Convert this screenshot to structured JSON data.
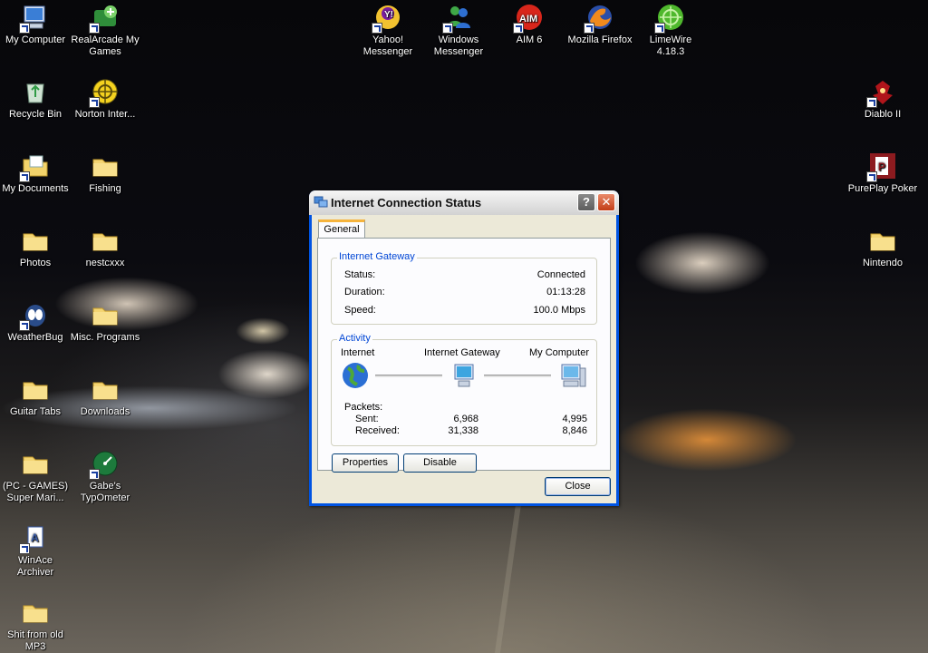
{
  "desktop": {
    "icons": [
      {
        "name": "my-computer",
        "label": "My Computer"
      },
      {
        "name": "realarcade",
        "label": "RealArcade My Games"
      },
      {
        "name": "yahoo-messenger",
        "label": "Yahoo! Messenger"
      },
      {
        "name": "windows-messenger",
        "label": "Windows Messenger"
      },
      {
        "name": "aim",
        "label": "AIM 6"
      },
      {
        "name": "firefox",
        "label": "Mozilla Firefox"
      },
      {
        "name": "limewire",
        "label": "LimeWire 4.18.3"
      },
      {
        "name": "recycle-bin",
        "label": "Recycle Bin"
      },
      {
        "name": "norton",
        "label": "Norton Inter..."
      },
      {
        "name": "diablo",
        "label": "Diablo II"
      },
      {
        "name": "my-documents",
        "label": "My Documents"
      },
      {
        "name": "fishing",
        "label": "Fishing"
      },
      {
        "name": "pureplay-poker",
        "label": "PurePlay Poker"
      },
      {
        "name": "photos",
        "label": "Photos"
      },
      {
        "name": "nestcxxx",
        "label": "nestcxxx"
      },
      {
        "name": "nintendo",
        "label": "Nintendo"
      },
      {
        "name": "weatherbug",
        "label": "WeatherBug"
      },
      {
        "name": "misc-programs",
        "label": "Misc. Programs"
      },
      {
        "name": "guitar-tabs",
        "label": "Guitar Tabs"
      },
      {
        "name": "downloads",
        "label": "Downloads"
      },
      {
        "name": "pc-games",
        "label": "(PC - GAMES) Super Mari..."
      },
      {
        "name": "typometer",
        "label": "Gabe's TypOmeter"
      },
      {
        "name": "winace",
        "label": "WinAce Archiver"
      },
      {
        "name": "shit-mp3",
        "label": "Shit from old MP3"
      }
    ]
  },
  "dialog": {
    "title": "Internet Connection Status",
    "help_label": "?",
    "close_x": "✕",
    "tab": "General",
    "gateway": {
      "title": "Internet Gateway",
      "status_label": "Status:",
      "status_value": "Connected",
      "duration_label": "Duration:",
      "duration_value": "01:13:28",
      "speed_label": "Speed:",
      "speed_value": "100.0 Mbps"
    },
    "activity": {
      "title": "Activity",
      "internet": "Internet",
      "gateway": "Internet Gateway",
      "computer": "My Computer",
      "packets": "Packets:",
      "sent_label": "Sent:",
      "received_label": "Received:",
      "gateway_sent": "6,968",
      "gateway_received": "31,338",
      "computer_sent": "4,995",
      "computer_received": "8,846"
    },
    "properties_label": "Properties",
    "disable_label": "Disable",
    "close_label": "Close"
  }
}
